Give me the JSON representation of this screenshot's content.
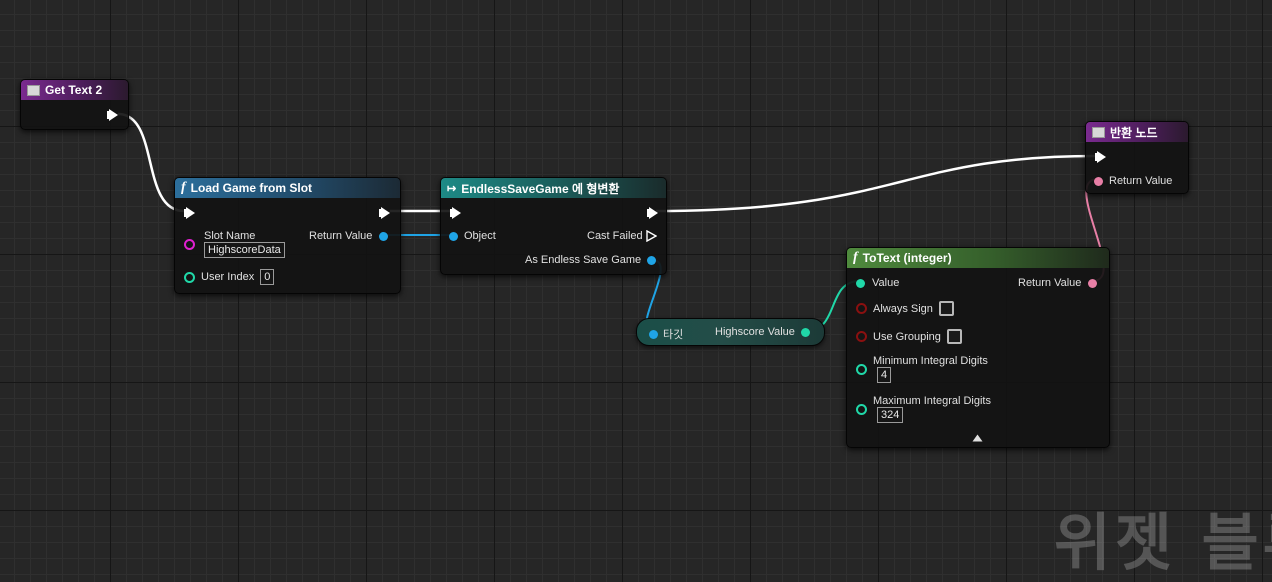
{
  "nodes": {
    "get_text": {
      "title": "Get Text 2"
    },
    "load_game": {
      "title": "Load Game from Slot",
      "slot_name_label": "Slot Name",
      "slot_name_value": "HighscoreData",
      "user_index_label": "User Index",
      "user_index_value": "0",
      "return_value_label": "Return Value"
    },
    "cast": {
      "title": "EndlessSaveGame 에 형변환",
      "object_label": "Object",
      "cast_failed_label": "Cast Failed",
      "as_label": "As Endless Save Game"
    },
    "getter": {
      "target_label": "타깃",
      "output_label": "Highscore Value"
    },
    "to_text": {
      "title": "ToText (integer)",
      "value_label": "Value",
      "return_value_label": "Return Value",
      "always_sign_label": "Always Sign",
      "use_grouping_label": "Use Grouping",
      "min_digits_label": "Minimum Integral Digits",
      "min_digits_value": "4",
      "max_digits_label": "Maximum Integral Digits",
      "max_digits_value": "324"
    },
    "return_node": {
      "title": "반환 노드",
      "return_value_label": "Return Value"
    }
  },
  "watermark": "위젯 블루",
  "colors": {
    "exec_wire": "#ffffff",
    "object_pin": "#1fa4e6",
    "string_pin": "#e020d0",
    "int_pin": "#20d8a8",
    "text_pin": "#e87fa6",
    "bool_pin": "#8a1010"
  }
}
